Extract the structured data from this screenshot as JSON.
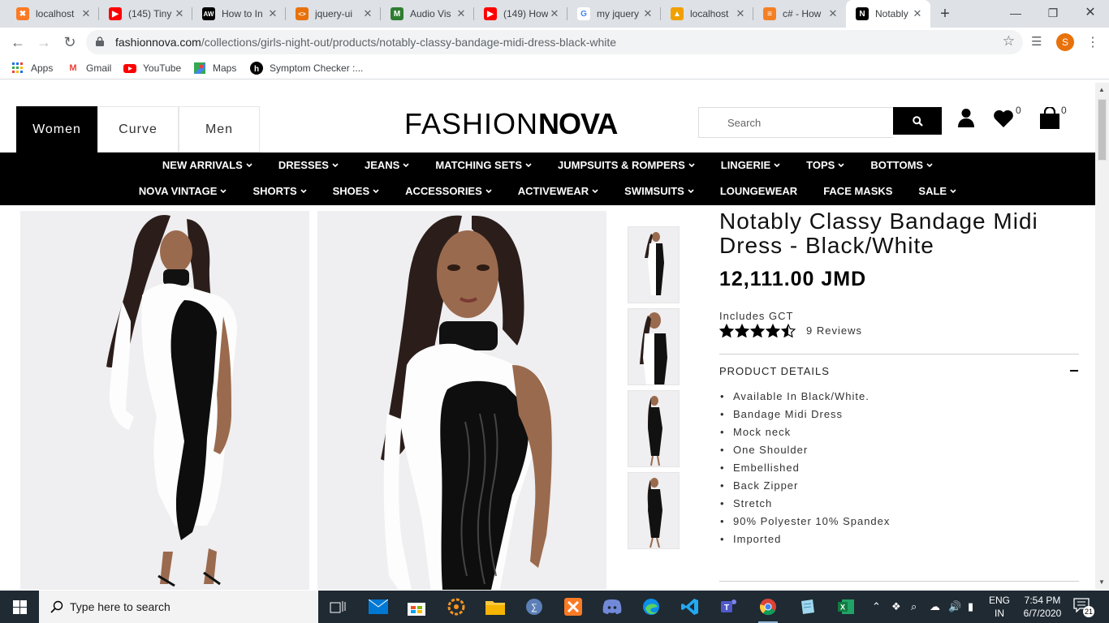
{
  "browser": {
    "tabs": [
      {
        "title": "localhost",
        "icon": "xampp-icon",
        "color": "#fb7a24",
        "active": false
      },
      {
        "title": "(145) Tiny",
        "icon": "youtube-icon",
        "color": "#ff0000",
        "active": false
      },
      {
        "title": "How to In",
        "icon": "aw-icon",
        "color": "#000000",
        "active": false
      },
      {
        "title": "jquery-ui",
        "icon": "code-icon",
        "color": "#e8710a",
        "active": false
      },
      {
        "title": "Audio Vis",
        "icon": "m-icon",
        "color": "#2e7d32",
        "active": false
      },
      {
        "title": "(149) How",
        "icon": "youtube-icon",
        "color": "#ff0000",
        "active": false
      },
      {
        "title": "my jquery",
        "icon": "google-icon",
        "color": "#4285f4",
        "active": false
      },
      {
        "title": "localhost",
        "icon": "pma-icon",
        "color": "#f0a000",
        "active": false
      },
      {
        "title": "c# - How",
        "icon": "stackoverflow-icon",
        "color": "#f48024",
        "active": false
      },
      {
        "title": "Notably C",
        "icon": "nova-icon",
        "color": "#000000",
        "active": true
      }
    ],
    "url_host": "fashionnova.com",
    "url_path": "/collections/girls-night-out/products/notably-classy-bandage-midi-dress-black-white",
    "profile_initial": "S",
    "bookmarks": [
      {
        "label": "Apps",
        "icon": "apps-grid-icon"
      },
      {
        "label": "Gmail",
        "icon": "gmail-icon"
      },
      {
        "label": "YouTube",
        "icon": "youtube-icon"
      },
      {
        "label": "Maps",
        "icon": "maps-icon"
      },
      {
        "label": "Symptom Checker :...",
        "icon": "symptom-checker-icon"
      }
    ]
  },
  "site": {
    "gender_tabs": [
      "Women",
      "Curve",
      "Men"
    ],
    "logo_light": "FASHION",
    "logo_bold": "NOVA",
    "search_placeholder": "Search",
    "wishlist_count": "0",
    "cart_count": "0",
    "menu_row1": [
      "NEW ARRIVALS",
      "DRESSES",
      "JEANS",
      "MATCHING SETS",
      "JUMPSUITS & ROMPERS",
      "LINGERIE",
      "TOPS",
      "BOTTOMS"
    ],
    "menu_row2": [
      "NOVA VINTAGE",
      "SHORTS",
      "SHOES",
      "ACCESSORIES",
      "ACTIVEWEAR",
      "SWIMSUITS",
      "LOUNGEWEAR",
      "FACE MASKS",
      "SALE"
    ],
    "menu_row2_chevrons": [
      true,
      true,
      true,
      true,
      true,
      true,
      false,
      false,
      true
    ]
  },
  "product": {
    "title": "Notably Classy Bandage Midi Dress - Black/White",
    "price": "12,111.00 JMD",
    "tax_note": "Includes GCT",
    "rating": 4.5,
    "reviews": "9 Reviews",
    "details_label": "PRODUCT DETAILS",
    "details": [
      "Available In Black/White.",
      "Bandage Midi Dress",
      "Mock neck",
      "One Shoulder",
      "Embellished",
      "Back Zipper",
      "Stretch",
      "90% Polyester 10% Spandex",
      "Imported"
    ]
  },
  "taskbar": {
    "search_placeholder": "Type here to search",
    "lang_line1": "ENG",
    "lang_line2": "IN",
    "time": "7:54 PM",
    "date": "6/7/2020",
    "notification_count": "21"
  }
}
